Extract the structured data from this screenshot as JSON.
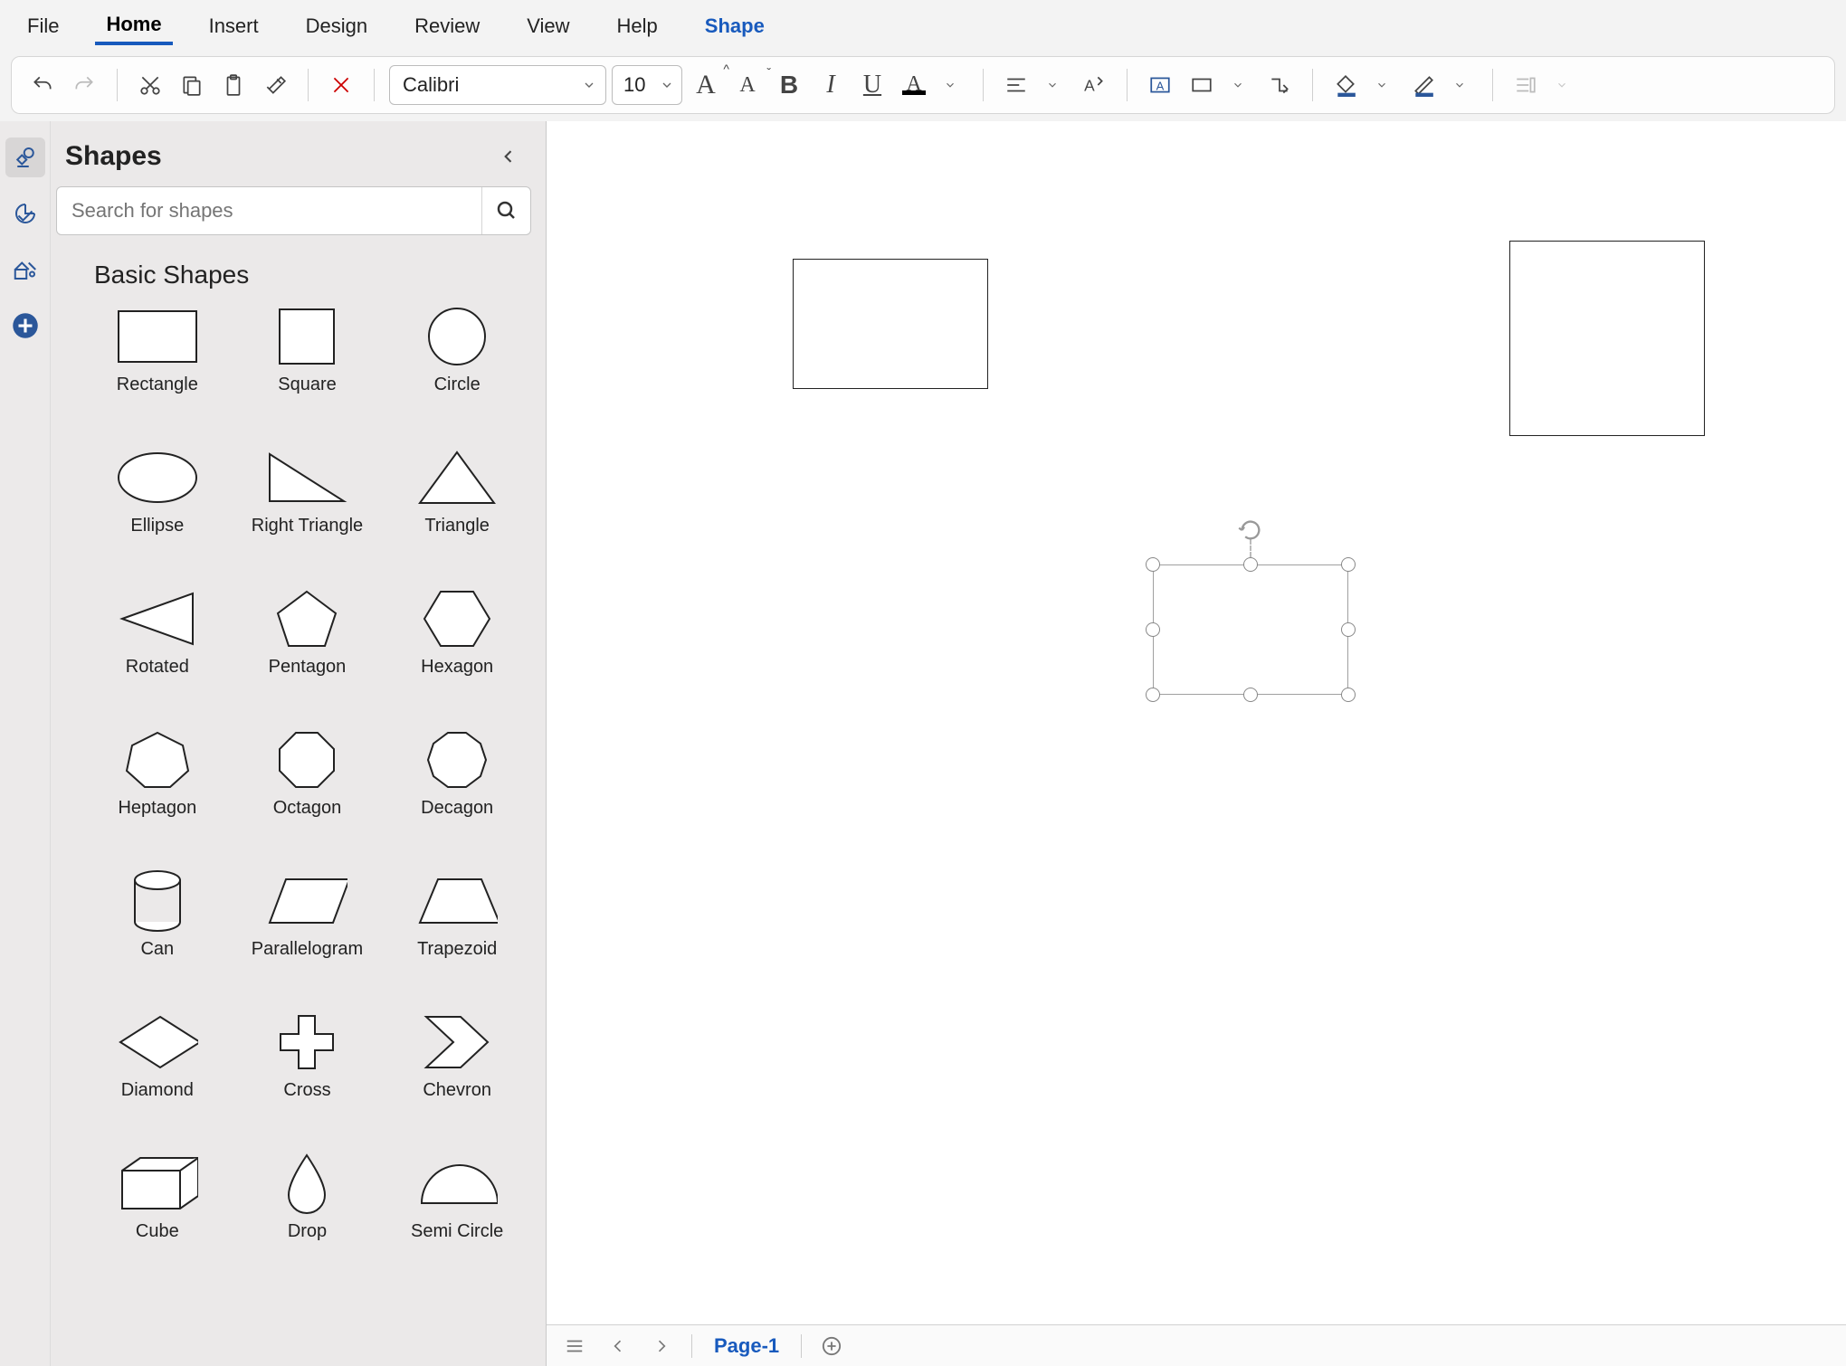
{
  "menu": {
    "items": [
      {
        "label": "File"
      },
      {
        "label": "Home"
      },
      {
        "label": "Insert"
      },
      {
        "label": "Design"
      },
      {
        "label": "Review"
      },
      {
        "label": "View"
      },
      {
        "label": "Help"
      },
      {
        "label": "Shape"
      }
    ],
    "active_index": 1,
    "context_index": 7
  },
  "toolbar": {
    "font_name": "Calibri",
    "font_size": "10"
  },
  "panel": {
    "title": "Shapes",
    "search_placeholder": "Search for shapes",
    "section": "Basic Shapes",
    "shapes": [
      {
        "name": "Rectangle"
      },
      {
        "name": "Square"
      },
      {
        "name": "Circle"
      },
      {
        "name": "Ellipse"
      },
      {
        "name": "Right Triangle"
      },
      {
        "name": "Triangle"
      },
      {
        "name": "Rotated"
      },
      {
        "name": "Pentagon"
      },
      {
        "name": "Hexagon"
      },
      {
        "name": "Heptagon"
      },
      {
        "name": "Octagon"
      },
      {
        "name": "Decagon"
      },
      {
        "name": "Can"
      },
      {
        "name": "Parallelogram"
      },
      {
        "name": "Trapezoid"
      },
      {
        "name": "Diamond"
      },
      {
        "name": "Cross"
      },
      {
        "name": "Chevron"
      },
      {
        "name": "Cube"
      },
      {
        "name": "Drop"
      },
      {
        "name": "Semi Circle"
      }
    ]
  },
  "statusbar": {
    "page_label": "Page-1"
  }
}
